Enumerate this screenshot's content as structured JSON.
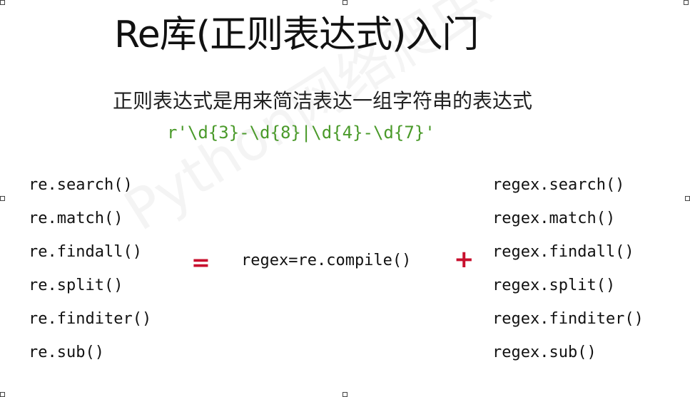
{
  "slide": {
    "title": "Re库(正则表达式)入门",
    "subtitle": "正则表达式是用来简洁表达一组字符串的表达式",
    "regex_example": "r'\\d{3}-\\d{8}|\\d{4}-\\d{7}'",
    "left_functions": [
      "re.search()",
      "re.match()",
      "re.findall()",
      "re.split()",
      "re.finditer()",
      "re.sub()"
    ],
    "equals_sign": "=",
    "compile_text": "regex=re.compile()",
    "plus_sign": "+",
    "right_functions": [
      "regex.search()",
      "regex.match()",
      "regex.findall()",
      "regex.split()",
      "regex.finditer()",
      "regex.sub()"
    ],
    "watermark": "Python网络爬虫与信息提取"
  },
  "colors": {
    "regex_example": "#4a9a2a",
    "operators": "#c8102e",
    "text": "#111111"
  }
}
